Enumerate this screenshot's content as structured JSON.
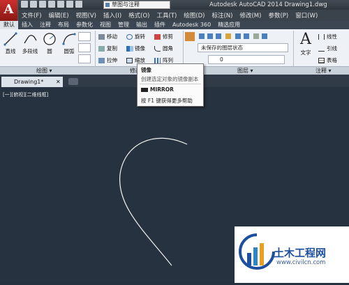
{
  "app": {
    "logo_letter": "A",
    "title": "Autodesk AutoCAD 2014    Drawing1.dwg",
    "workspace": "草图与注释"
  },
  "menubar": [
    "文件(F)",
    "编辑(E)",
    "视图(V)",
    "插入(I)",
    "格式(O)",
    "工具(T)",
    "绘图(D)",
    "标注(N)",
    "修改(M)",
    "参数(P)",
    "窗口(W)"
  ],
  "ribbon_tabs": [
    "默认",
    "插入",
    "注释",
    "布局",
    "参数化",
    "视图",
    "管理",
    "输出",
    "插件",
    "Autodesk 360",
    "精选应用"
  ],
  "draw_panel": {
    "title": "绘图 ▾",
    "tools": [
      "直线",
      "多段线",
      "圆",
      "圆弧"
    ]
  },
  "modify_panel": {
    "title": "修改 ▾",
    "tools": [
      "移动",
      "旋转",
      "修剪",
      "复制",
      "镜像",
      "圆角",
      "拉伸",
      "缩放",
      "阵列"
    ]
  },
  "layer_panel": {
    "title": "图层 ▾",
    "state": "未保存的图层状态",
    "current_layer": "0"
  },
  "annotation_panel": {
    "title": "注释 ▾",
    "text_tool": "文字",
    "tools": [
      "线性",
      "引线",
      "表格"
    ]
  },
  "tooltip": {
    "title": "镜像",
    "description": "创建选定对象的镜像副本",
    "command": "MIRROR",
    "help": "按 F1 键获得更多帮助"
  },
  "document": {
    "tab": "Drawing1*",
    "viewport_label": "[一][俯视][二维线框]"
  },
  "watermark": {
    "name": "土木工程网",
    "url": "www.civilcn.com"
  },
  "colors": {
    "viewport_bg": "#263240",
    "highlight": "#e02b2b",
    "curve": "#ffffff"
  }
}
